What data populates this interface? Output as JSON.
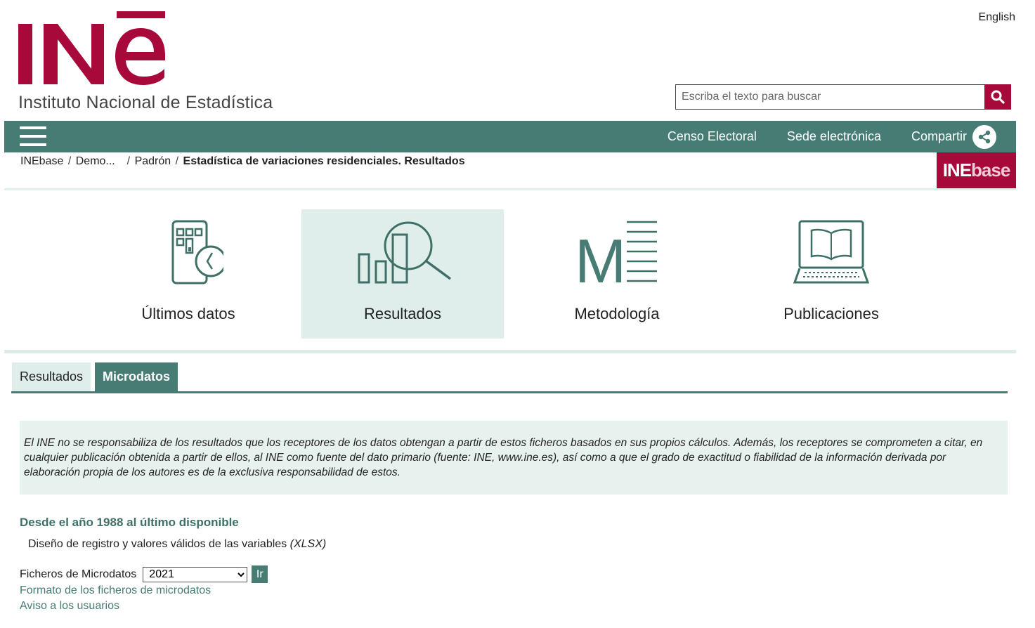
{
  "header": {
    "language_link": "English",
    "logo_text": "INE",
    "org_name": "Instituto Nacional de Estadística",
    "search_placeholder": "Escriba el texto para buscar",
    "search_icon": "search-icon"
  },
  "nav": {
    "menu_icon": "hamburger-menu-icon",
    "links": [
      {
        "label": "Censo Electoral"
      },
      {
        "label": "Sede electrónica"
      },
      {
        "label": "Compartir",
        "icon": "share-icon"
      }
    ]
  },
  "breadcrumb": {
    "items": [
      "INEbase",
      "Demo...",
      "Padrón"
    ],
    "current": "Estadística de variaciones residenciales. Resultados"
  },
  "inebase_logo": {
    "text_ine": "INE",
    "text_base": "base"
  },
  "tiles": [
    {
      "label": "Últimos datos",
      "icon": "calendar-clock-icon"
    },
    {
      "label": "Resultados",
      "icon": "chart-magnifier-icon",
      "active": true
    },
    {
      "label": "Metodología",
      "icon": "methodology-document-icon"
    },
    {
      "label": "Publicaciones",
      "icon": "laptop-book-icon"
    }
  ],
  "tabs": [
    {
      "label": "Resultados",
      "active": false
    },
    {
      "label": "Microdatos",
      "active": true
    }
  ],
  "notice": "El INE no se responsabiliza de los resultados que los receptores de los datos obtengan a partir de estos ficheros basados en sus propios cálculos. Además, los receptores se comprometen a citar, en cualquier publicación obtenida a partir de ellos, al INE como fuente del dato primario (fuente: INE, www.ine.es), así como a que el grado de exactitud o fiabilidad de la información derivada por elaboración propia de los autores es de la exclusiva responsabilidad de estos.",
  "section": {
    "title": "Desde el año 1988 al último disponible",
    "design_link": "Diseño de registro y valores válidos de las variables",
    "design_format": "(XLSX)",
    "microdata_label": "Ficheros de Microdatos",
    "selected_year": "2021",
    "go_button": "Ir",
    "format_link": "Formato de los ficheros de microdatos",
    "notice_link": "Aviso a los usuarios"
  },
  "colors": {
    "brand_red": "#a6093a",
    "brand_green": "#477c74",
    "light_green": "#e0eeeb"
  }
}
